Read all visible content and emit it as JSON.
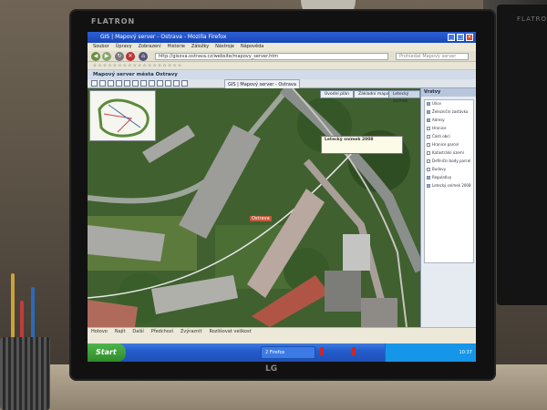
{
  "monitor": {
    "brand": "FLATRON",
    "maker": "LG"
  },
  "right_monitor": {
    "brand": "FLATRON"
  },
  "browser": {
    "title": "GIS | Mapový server - Ostrava - Mozilla Firefox",
    "menu": [
      "Soubor",
      "Úpravy",
      "Zobrazení",
      "Historie",
      "Záložky",
      "Nástroje",
      "Nápověda"
    ],
    "url": "http://gisova.ostrava.cz/website/mapovy_server.htm",
    "search_placeholder": "Prohledat Mapový server"
  },
  "app": {
    "header": "Mapový server města Ostravy",
    "tab_label": "GIS | Mapový server - Ostrava"
  },
  "map": {
    "tabs": [
      "Úvodní plán",
      "Základní mapa",
      "Letecký snímek"
    ],
    "tooltip_title": "Letecký snímek 2008",
    "label": "Ostrava"
  },
  "sidepanel": {
    "header": "Vrstvy",
    "items": [
      {
        "label": "Ulice",
        "checked": true
      },
      {
        "label": "Železniční zastávka",
        "checked": true
      },
      {
        "label": "Adresy",
        "checked": true
      },
      {
        "label": "Hranice",
        "checked": false
      },
      {
        "label": "Části obcí",
        "checked": false
      },
      {
        "label": "Hranice parcel",
        "checked": false
      },
      {
        "label": "Katastrální území",
        "checked": false
      },
      {
        "label": "Definiční body parcel",
        "checked": false
      },
      {
        "label": "Budovy",
        "checked": false
      },
      {
        "label": "Regulativy",
        "checked": true
      },
      {
        "label": "Letecký snímek 2008",
        "checked": true
      }
    ],
    "info_label": "Informace",
    "button_label": "Základní mapa"
  },
  "statusbar": {
    "items": [
      "Hotovo",
      "Najít",
      "Další",
      "Předchozí",
      "Zvýraznit",
      "Rozlišovat velikost"
    ]
  },
  "taskbar": {
    "start_label": "Start",
    "task": "2 Firefox",
    "tray_time": "10:37"
  }
}
